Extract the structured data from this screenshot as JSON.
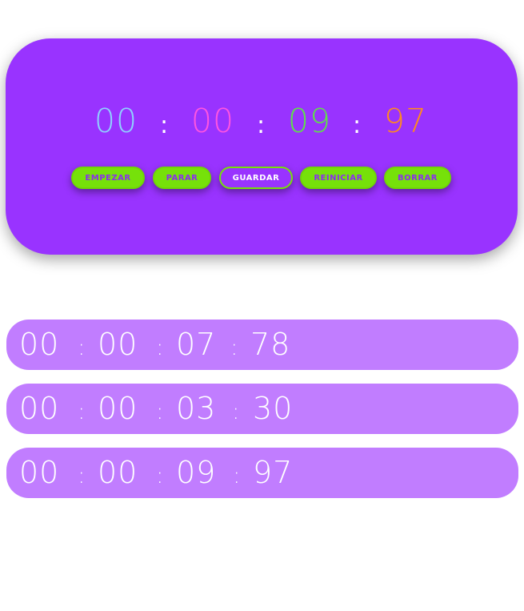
{
  "timer": {
    "hours": "00",
    "minutes": "00",
    "seconds": "09",
    "centiseconds": "97",
    "separator": ":",
    "colors": {
      "hours": "#8fd0ff",
      "minutes": "#ff55e1",
      "seconds": "#5fe04a",
      "centiseconds": "#ff8a1f"
    }
  },
  "buttons": {
    "start": "EMPEZAR",
    "stop": "PARAR",
    "save": "GUARDAR",
    "reset": "REINICIAR",
    "clear": "BORRAR"
  },
  "laps": [
    {
      "hours": "00",
      "minutes": "00",
      "seconds": "07",
      "centiseconds": "78"
    },
    {
      "hours": "00",
      "minutes": "00",
      "seconds": "03",
      "centiseconds": "30"
    },
    {
      "hours": "00",
      "minutes": "00",
      "seconds": "09",
      "centiseconds": "97"
    }
  ],
  "colors": {
    "card": "#9933ff",
    "button": "#76e10a",
    "lap": "#c17dff"
  }
}
